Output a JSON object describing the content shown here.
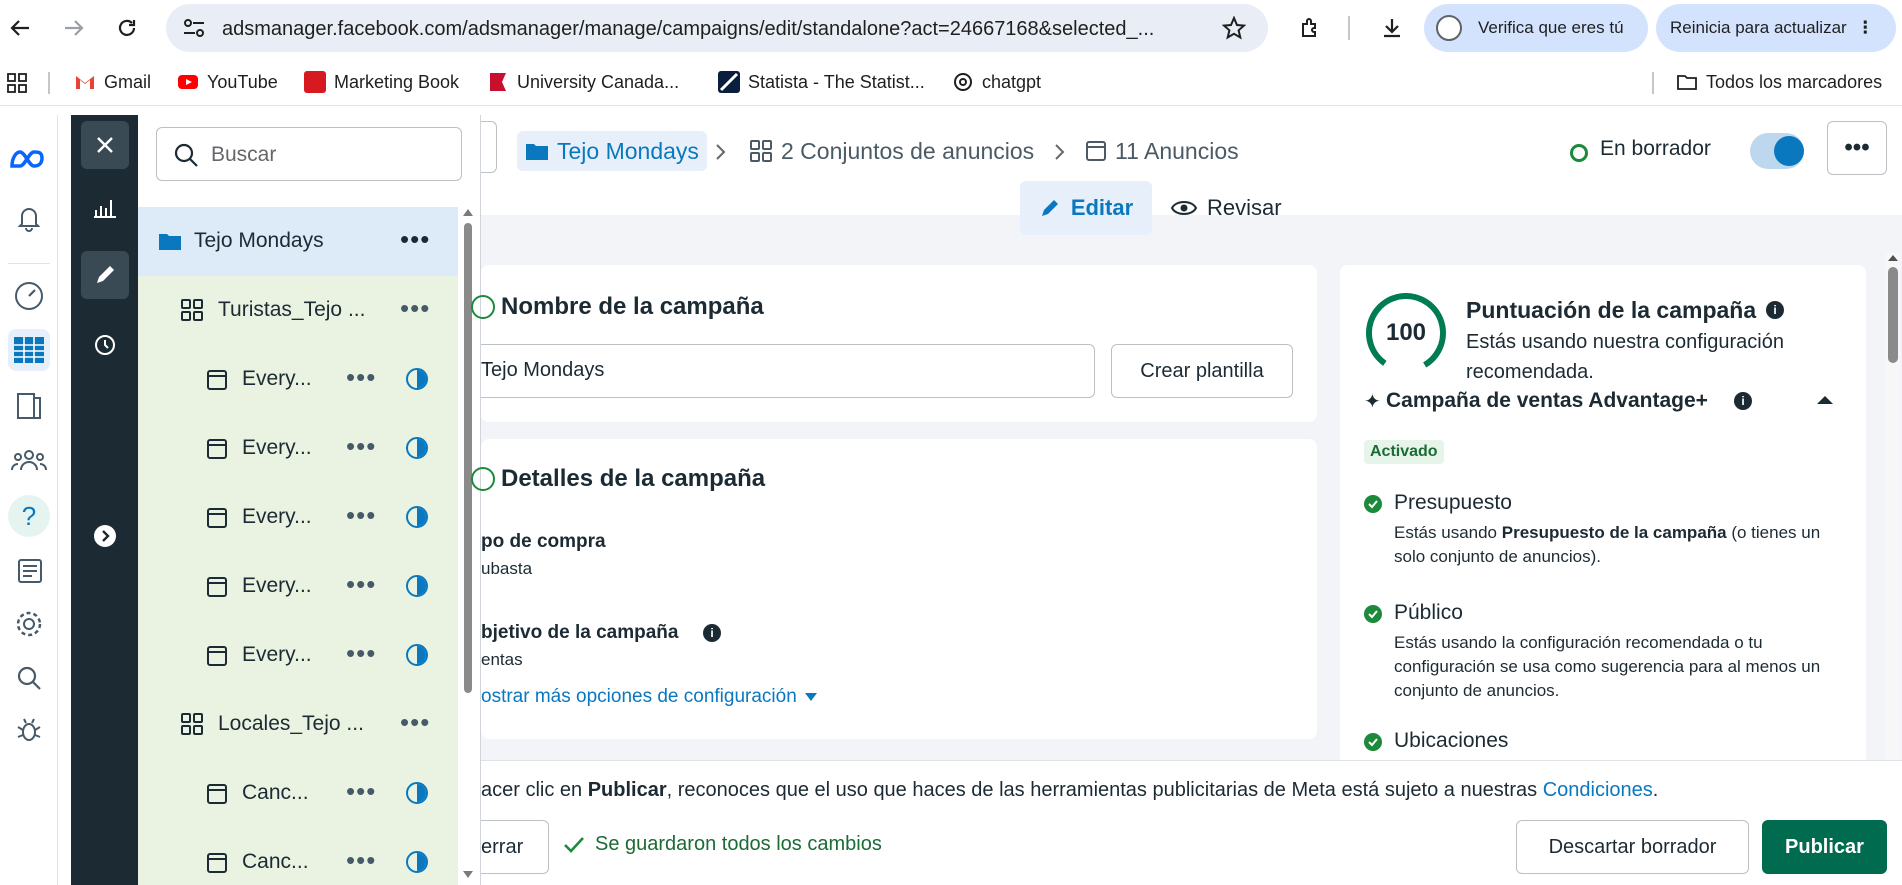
{
  "browser": {
    "url": "adsmanager.facebook.com/adsmanager/manage/campaigns/edit/standalone?act=24667168&selected_...",
    "verify_label": "Verifica que eres tú",
    "restart_label": "Reinicia para actualizar"
  },
  "bookmarks": {
    "items": [
      {
        "label": "Gmail",
        "icon": "gmail-icon",
        "color": "#ea4335"
      },
      {
        "label": "YouTube",
        "icon": "youtube-icon",
        "color": "#ff0000"
      },
      {
        "label": "Marketing Book",
        "icon": "mcgraw-hill-icon",
        "color": "#d71920"
      },
      {
        "label": "University Canada...",
        "icon": "university-canada-icon",
        "color": "#c8102e"
      },
      {
        "label": "Statista - The Statist...",
        "icon": "statista-icon",
        "color": "#0b1e3d"
      },
      {
        "label": "chatgpt",
        "icon": "chatgpt-icon",
        "color": "#1f1f1f"
      }
    ],
    "all_bookmarks": "Todos los marcadores"
  },
  "tree": {
    "search_placeholder": "Buscar",
    "campaign": "Tejo Mondays",
    "adsets": [
      {
        "name": "Turistas_Tejo ...",
        "ads": [
          "Every...",
          "Every...",
          "Every...",
          "Every...",
          "Every..."
        ]
      },
      {
        "name": "Locales_Tejo ...",
        "ads": [
          "Canc...",
          "Canc..."
        ]
      }
    ]
  },
  "breadcrumb": {
    "campaign": "Tejo Mondays",
    "adsets": "2 Conjuntos de anuncios",
    "ads": "11 Anuncios",
    "status": "En borrador"
  },
  "modes": {
    "edit": "Editar",
    "review": "Revisar"
  },
  "campaign_name": {
    "title": "Nombre de la campaña",
    "value": "Tejo Mondays",
    "template_button": "Crear plantilla"
  },
  "details": {
    "title": "Detalles de la campaña",
    "buy_type_label": "po de compra",
    "buy_type_value": "ubasta",
    "objective_label": "bjetivo de la campaña",
    "objective_value": "entas",
    "more_options": "ostrar más opciones de configuración"
  },
  "score": {
    "value": "100",
    "title": "Puntuación de la campaña",
    "subtitle": "Estás usando nuestra configuración recomendada.",
    "advantage_title": "Campaña de ventas Advantage+",
    "advantage_badge": "Activado",
    "items": [
      {
        "title": "Presupuesto",
        "desc_pre": "Estás usando ",
        "desc_bold": "Presupuesto de la campaña",
        "desc_post": " (o tienes un solo conjunto de anuncios)."
      },
      {
        "title": "Público",
        "desc_pre": "Estás usando la configuración recomendada o tu configuración se usa como sugerencia para al menos un conjunto de anuncios.",
        "desc_bold": "",
        "desc_post": ""
      },
      {
        "title": "Ubicaciones",
        "desc_pre": "",
        "desc_bold": "",
        "desc_post": ""
      }
    ]
  },
  "footer": {
    "terms_pre": "acer clic en ",
    "terms_bold": "Publicar",
    "terms_mid": ", reconoces que el uso que haces de las herramientas publicitarias de Meta está sujeto a nuestras ",
    "terms_link": "Condiciones",
    "terms_end": ".",
    "close_button": "errar",
    "saved_status": "Se guardaron todos los cambios",
    "discard_button": "Descartar borrador",
    "publish_button": "Publicar"
  },
  "colors": {
    "accent": "#0a78be",
    "publish": "#006b4f",
    "success": "#1b8a3a",
    "score_ring": "#007c53"
  }
}
